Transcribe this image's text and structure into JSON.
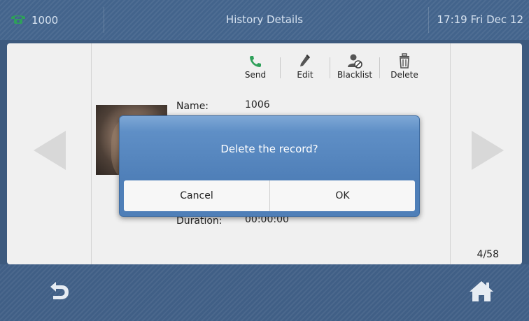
{
  "status_bar": {
    "line_number": "1000",
    "title": "History Details",
    "clock": "17:19 Fri Dec 12"
  },
  "toolbar": {
    "send": "Send",
    "edit": "Edit",
    "blacklist": "Blacklist",
    "delete": "Delete"
  },
  "details": {
    "name_label": "Name:",
    "name_value": "1006",
    "duration_label": "Duration:",
    "duration_value": "00:00:00"
  },
  "pager": "4/58",
  "dialog": {
    "message": "Delete the record?",
    "cancel": "Cancel",
    "ok": "OK"
  },
  "colors": {
    "accent": "#4f7fb8",
    "bar": "#43648c",
    "phone_icon": "#2fa05a"
  },
  "icons": {
    "line": "phone-icon",
    "send": "phone-icon",
    "edit": "pencil-icon",
    "blacklist": "user-block-icon",
    "delete": "trash-icon",
    "back": "back-arrow-icon",
    "home": "home-icon"
  }
}
